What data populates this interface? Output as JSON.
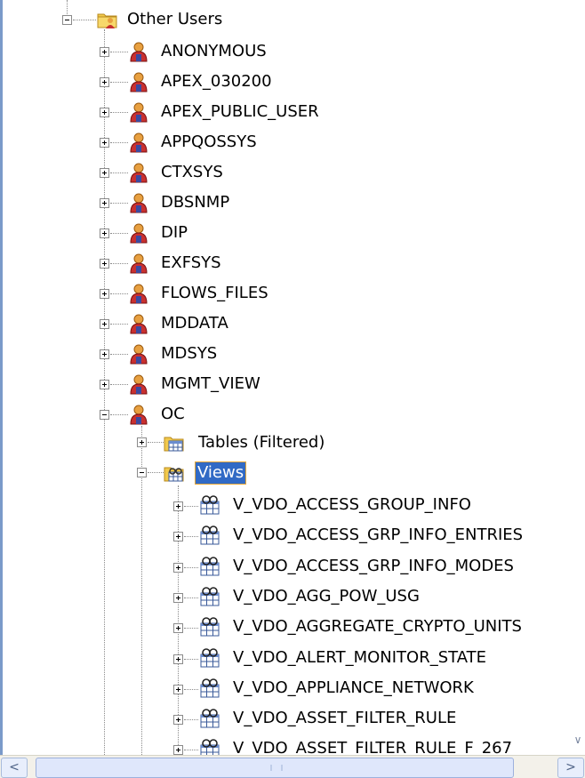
{
  "tree": {
    "other_users": {
      "label": "Other Users",
      "icon": "folder-users-icon"
    },
    "users": [
      {
        "label": "ANONYMOUS"
      },
      {
        "label": "APEX_030200"
      },
      {
        "label": "APEX_PUBLIC_USER"
      },
      {
        "label": "APPQOSSYS"
      },
      {
        "label": "CTXSYS"
      },
      {
        "label": "DBSNMP"
      },
      {
        "label": "DIP"
      },
      {
        "label": "EXFSYS"
      },
      {
        "label": "FLOWS_FILES"
      },
      {
        "label": "MDDATA"
      },
      {
        "label": "MDSYS"
      },
      {
        "label": "MGMT_VIEW"
      },
      {
        "label": "OC"
      }
    ],
    "oc_children": {
      "tables": {
        "label": "Tables (Filtered)",
        "icon": "tables-folder-icon"
      },
      "views": {
        "label": "Views",
        "icon": "views-folder-icon",
        "selected": true
      }
    },
    "views": [
      {
        "label": "V_VDO_ACCESS_GROUP_INFO"
      },
      {
        "label": "V_VDO_ACCESS_GRP_INFO_ENTRIES"
      },
      {
        "label": "V_VDO_ACCESS_GRP_INFO_MODES"
      },
      {
        "label": "V_VDO_AGG_POW_USG"
      },
      {
        "label": "V_VDO_AGGREGATE_CRYPTO_UNITS"
      },
      {
        "label": "V_VDO_ALERT_MONITOR_STATE"
      },
      {
        "label": "V_VDO_APPLIANCE_NETWORK"
      },
      {
        "label": "V_VDO_ASSET_FILTER_RULE"
      },
      {
        "label": "V_VDO_ASSET_FILTER_RULE_F_267"
      }
    ]
  },
  "scrollbar": {
    "left_arrow": "<",
    "right_arrow": ">"
  },
  "colors": {
    "selection": "#316ac5",
    "user_icon_head": "#e8a040",
    "user_icon_body": "#c83030"
  }
}
